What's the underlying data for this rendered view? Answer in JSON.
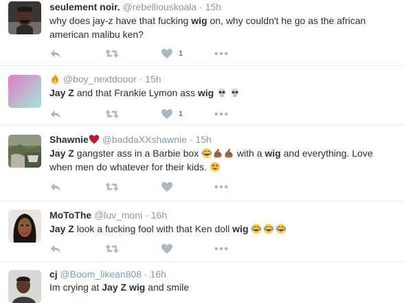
{
  "tweets": [
    {
      "name": "seulement noir.",
      "handle": "@rebelliouskoala",
      "time": "15h",
      "text_before": "why does jay-z have that fucking ",
      "keyword": "wig",
      "text_after": " on, why couldn't he go as the african american malibu ken?",
      "likes": "1",
      "name_emoji": "",
      "inline_emojis": []
    },
    {
      "name": "",
      "handle": "@boy_nextdooor",
      "time": "15h",
      "bold_lead": "Jay Z",
      "text_before": " and that Frankie Lymon ass ",
      "keyword": "wig",
      "text_after": "",
      "likes": "1",
      "name_emoji": "fire-emoji",
      "inline_emojis": [
        "skull-emoji",
        "skull-emoji"
      ]
    },
    {
      "name": "Shawnie",
      "handle": "@baddaXXshawnie",
      "time": "15h",
      "bold_lead": "Jay Z",
      "text_before": " gangster ass in a Barbie box ",
      "text_mid": " with a ",
      "keyword": "wig",
      "text_after": " and everything. Love when men do whatever for their kids. ",
      "likes": "",
      "name_emoji": "heart-emoji",
      "inline_emojis": [
        "laugh-cry-emoji",
        "flexed-biceps-emoji",
        "flexed-biceps-emoji",
        "heart-eyes-emoji"
      ]
    },
    {
      "name": "MoToThe",
      "handle": "@luv_moni",
      "time": "16h",
      "bold_lead": "Jay Z",
      "text_before": " look a fucking fool with that Ken doll ",
      "keyword": "wig",
      "text_after": "",
      "likes": "",
      "name_emoji": "",
      "inline_emojis": [
        "laugh-cry-emoji",
        "laugh-cry-emoji",
        "laugh-cry-emoji"
      ]
    },
    {
      "name": "cj",
      "handle": "@Boom_likean808",
      "time": "16h",
      "text_before": "Im crying at ",
      "bold_lead": "Jay Z",
      "keyword": "wig",
      "text_after": " and smile",
      "likes": "",
      "name_emoji": "",
      "inline_emojis": []
    }
  ],
  "separator": "·",
  "icons": [
    "reply-icon",
    "retweet-icon",
    "like-icon",
    "more-icon"
  ],
  "colors": {
    "action_gray": "#aab8c2",
    "meta_gray": "#8899a6",
    "text": "#292f33",
    "divider": "#e6ecf0"
  }
}
